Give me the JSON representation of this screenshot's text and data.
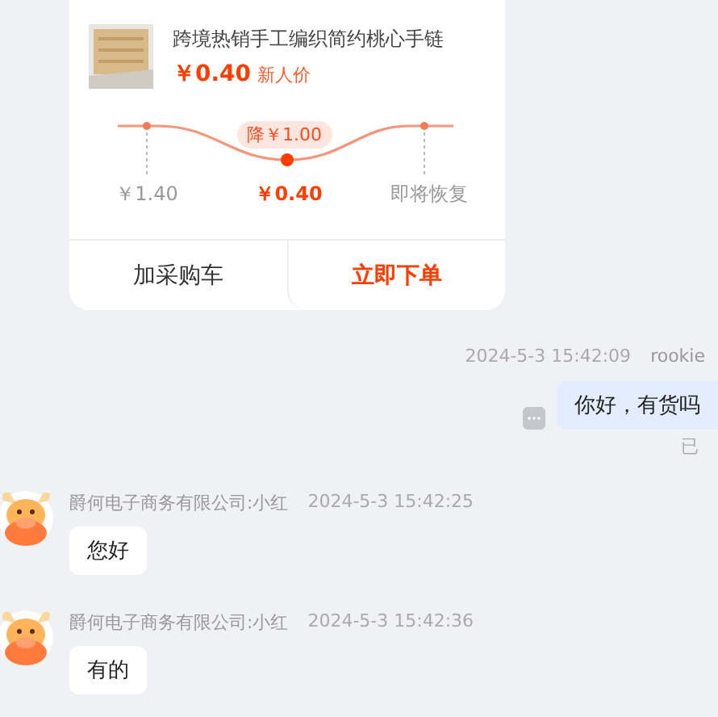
{
  "product_card": {
    "title": "跨境热销手工编织简约桃心手链",
    "price": "￥0.40",
    "price_tag": "新人价",
    "drop_badge": "降￥1.00",
    "price_points": [
      {
        "label": "￥1.40",
        "current": false
      },
      {
        "label": "￥0.40",
        "current": true
      },
      {
        "label": "即将恢复",
        "current": false
      }
    ],
    "buttons": [
      {
        "label": "加采购车",
        "primary": false
      },
      {
        "label": "立即下单",
        "primary": true
      }
    ]
  },
  "messages": [
    {
      "kind": "out",
      "time": "2024-5-3 15:42:09",
      "sender": "rookie",
      "text": "你好，有货吗",
      "status": "已"
    },
    {
      "kind": "in",
      "sender": "爵何电子商务有限公司:小红",
      "time": "2024-5-3 15:42:25",
      "text": "您好"
    },
    {
      "kind": "in",
      "sender": "爵何电子商务有限公司:小红",
      "time": "2024-5-3 15:42:36",
      "text": "有的"
    }
  ]
}
